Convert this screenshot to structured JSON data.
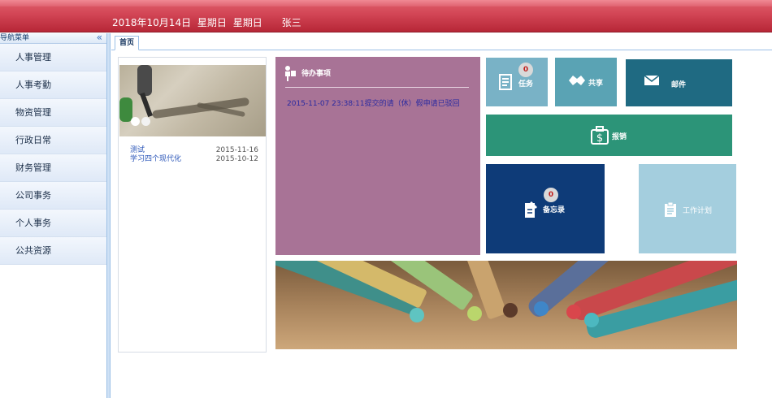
{
  "header": {
    "date": "2018年10月14日",
    "weekday1": "星期日",
    "weekday2": "星期日",
    "user": "张三",
    "bg_color": "#c93445"
  },
  "sidebar": {
    "title": "导航菜单",
    "collapse_glyph": "«",
    "items": [
      {
        "label": "人事管理"
      },
      {
        "label": "人事考勤"
      },
      {
        "label": "物资管理"
      },
      {
        "label": "行政日常"
      },
      {
        "label": "财务管理"
      },
      {
        "label": "公司事务"
      },
      {
        "label": "个人事务"
      },
      {
        "label": "公共资源"
      }
    ]
  },
  "tabs": [
    {
      "label": "首页",
      "active": true
    }
  ],
  "news": {
    "items": [
      {
        "title": "测试",
        "date": "2015-11-16"
      },
      {
        "title": "学习四个现代化",
        "date": "2015-10-12"
      }
    ]
  },
  "todo": {
    "title": "待办事项",
    "items": [
      {
        "text": "2015-11-07 23:38:11提交的请（休）假申请已驳回"
      }
    ],
    "color": "#a87396"
  },
  "tiles": {
    "task": {
      "label": "任务",
      "badge": "0",
      "color": "#79b2c6",
      "icon": "task-list-icon"
    },
    "share": {
      "label": "共享",
      "color": "#5aa3b4",
      "icon": "handshake-icon"
    },
    "mail": {
      "label": "邮件",
      "color": "#1f6a82",
      "icon": "mail-icon"
    },
    "reimburse": {
      "label": "报销",
      "color": "#2c9478",
      "icon": "money-bag-icon"
    },
    "memo": {
      "label": "备忘录",
      "badge": "0",
      "color": "#0e3b78",
      "icon": "memo-icon"
    },
    "plan": {
      "label": "工作计划",
      "color": "#a4cede",
      "icon": "clipboard-icon"
    }
  }
}
